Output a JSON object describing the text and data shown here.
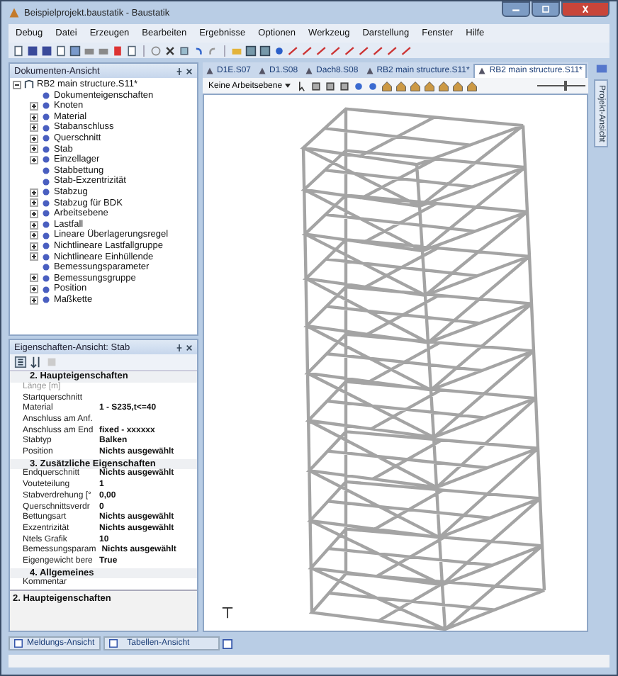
{
  "window": {
    "title": "Beispielprojekt.baustatik - Baustatik"
  },
  "menu": [
    "Debug",
    "Datei",
    "Erzeugen",
    "Bearbeiten",
    "Ergebnisse",
    "Optionen",
    "Werkzeug",
    "Darstellung",
    "Fenster",
    "Hilfe"
  ],
  "document_panel": {
    "title": "Dokumenten-Ansicht",
    "tree": [
      {
        "label": "RB2 main structure.S11*",
        "kind": "group",
        "expanded": true,
        "children": [
          {
            "label": "Dokumenteigenschaften",
            "kind": "leaf"
          },
          {
            "label": "Knoten",
            "kind": "group",
            "expanded": false
          },
          {
            "label": "Material",
            "kind": "group",
            "expanded": false
          },
          {
            "label": "Stabanschluss",
            "kind": "group",
            "expanded": false
          },
          {
            "label": "Querschnitt",
            "kind": "group",
            "expanded": false
          },
          {
            "label": "Stab",
            "kind": "group",
            "expanded": false
          },
          {
            "label": "Einzellager",
            "kind": "group",
            "expanded": false
          },
          {
            "label": "Stabbettung",
            "kind": "leaf"
          },
          {
            "label": "Stab-Exzentrizität",
            "kind": "leaf"
          },
          {
            "label": "Stabzug",
            "kind": "group",
            "expanded": false
          },
          {
            "label": "Stabzug für BDK",
            "kind": "group",
            "expanded": false
          },
          {
            "label": "Arbeitsebene",
            "kind": "group",
            "expanded": false
          },
          {
            "label": "Lastfall",
            "kind": "group",
            "expanded": false
          },
          {
            "label": "Lineare Überlagerungsregel",
            "kind": "group",
            "expanded": false
          },
          {
            "label": "Nichtlineare Lastfallgruppe",
            "kind": "group",
            "expanded": false
          },
          {
            "label": "Nichtlineare Einhüllende",
            "kind": "group",
            "expanded": false
          },
          {
            "label": "Bemessungsparameter",
            "kind": "leaf"
          },
          {
            "label": "Bemessungsgruppe",
            "kind": "group",
            "expanded": false
          },
          {
            "label": "Position",
            "kind": "group",
            "expanded": false
          },
          {
            "label": "Maßkette",
            "kind": "group",
            "expanded": false
          }
        ]
      }
    ]
  },
  "properties_panel": {
    "title": "Eigenschaften-Ansicht: Stab",
    "sections": [
      {
        "title": "2. Haupteigenschaften",
        "rows": [
          {
            "name": "Länge [m]",
            "disabled": true
          },
          {
            "name": "Startquerschnitt",
            "disabled": false
          },
          {
            "name": "Material",
            "value": "1 - S235,t<=40",
            "disabled": false
          },
          {
            "name": "Anschluss am Anf.",
            "disabled": false
          },
          {
            "name": "Anschluss am End",
            "value": "fixed - xxxxxx",
            "disabled": false
          },
          {
            "name": "Stabtyp",
            "value": "Balken",
            "disabled": false
          },
          {
            "name": "Position",
            "value": "Nichts ausgewählt",
            "disabled": false
          }
        ]
      },
      {
        "title": "3. Zusätzliche Eigenschaften",
        "rows": [
          {
            "name": "Endquerschnitt",
            "value": "Nichts ausgewählt",
            "disabled": false
          },
          {
            "name": "Vouteteilung",
            "value": "1",
            "disabled": false
          },
          {
            "name": "Stabverdrehung [°",
            "value": "0,00",
            "disabled": false
          },
          {
            "name": "Querschnittsverdr",
            "value": "0",
            "disabled": false
          },
          {
            "name": "Bettungsart",
            "value": "Nichts ausgewählt",
            "disabled": false
          },
          {
            "name": "Exzentrizität",
            "value": "Nichts ausgewählt",
            "disabled": false
          },
          {
            "name": "Ntels Grafik",
            "value": "10",
            "disabled": false
          },
          {
            "name": "Bemessungsparam",
            "value": "Nichts ausgewählt",
            "disabled": false
          },
          {
            "name": "Eigengewicht bere",
            "value": "True",
            "disabled": false
          }
        ]
      },
      {
        "title": "4. Allgemeines",
        "rows": [
          {
            "name": "Kommentar",
            "disabled": false
          }
        ]
      }
    ],
    "description": "2. Haupteigenschaften"
  },
  "document_tabs": [
    {
      "label": "D1E.S07",
      "selected": false
    },
    {
      "label": "D1.S08",
      "selected": false
    },
    {
      "label": "Dach8.S08",
      "selected": false
    },
    {
      "label": "RB2 main structure.S11*",
      "selected": false
    },
    {
      "label": "RB2 main structure.S11*",
      "selected": true
    }
  ],
  "viewport": {
    "plane_dropdown": "Keine Arbeitsebene",
    "zoom": {
      "level": 0.6
    }
  },
  "side_tab": "Projekt-Ansicht",
  "bottom_tabs": [
    "Meldungs-Ansicht",
    "Tabellen-Ansicht"
  ]
}
